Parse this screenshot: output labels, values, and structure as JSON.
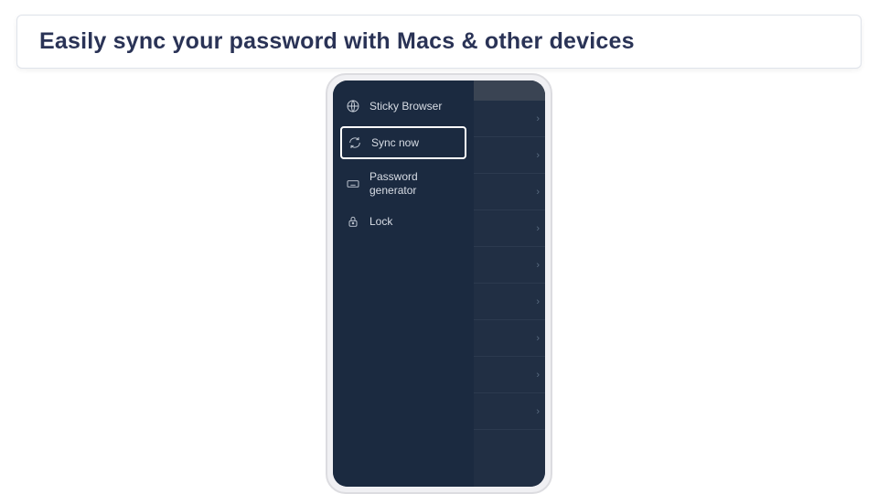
{
  "caption": "Easily sync your password with Macs & other devices",
  "drawer": {
    "items": [
      {
        "icon": "globe-icon",
        "label": "Sticky Browser",
        "highlight": false
      },
      {
        "icon": "sync-icon",
        "label": "Sync now",
        "highlight": true
      },
      {
        "icon": "keyboard-icon",
        "label": "Password generator",
        "highlight": false
      },
      {
        "icon": "lock-icon",
        "label": "Lock",
        "highlight": false
      }
    ]
  },
  "list": {
    "rows": 9
  },
  "colors": {
    "drawer_bg": "#1b2a40",
    "list_bg": "#212f44",
    "caption_text": "#2a3356",
    "highlight_border": "#ffffff"
  }
}
